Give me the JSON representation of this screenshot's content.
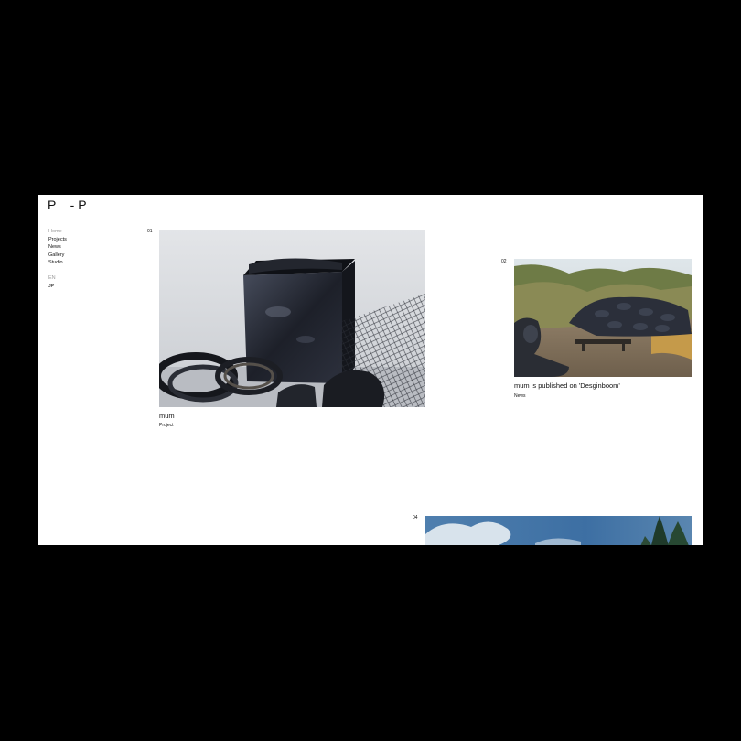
{
  "site": {
    "logo": "P    - P"
  },
  "nav": {
    "items": [
      {
        "label": "Home",
        "active": true
      },
      {
        "label": "Projects",
        "active": false
      },
      {
        "label": "News",
        "active": false
      },
      {
        "label": "Gallery",
        "active": false
      },
      {
        "label": "Studio",
        "active": false
      }
    ]
  },
  "lang": {
    "items": [
      {
        "label": "EN",
        "active": true
      },
      {
        "label": "JP",
        "active": false
      }
    ]
  },
  "cards": [
    {
      "number": "01",
      "title": "mum",
      "category": "Project",
      "image": "black-sculpture-photo"
    },
    {
      "number": "02",
      "title": "mum is published on 'Desginboom'",
      "category": "News",
      "image": "tire-pile-landscape-photo"
    },
    {
      "number": "04",
      "title": "",
      "category": "",
      "image": "sky-trees-photo"
    }
  ]
}
